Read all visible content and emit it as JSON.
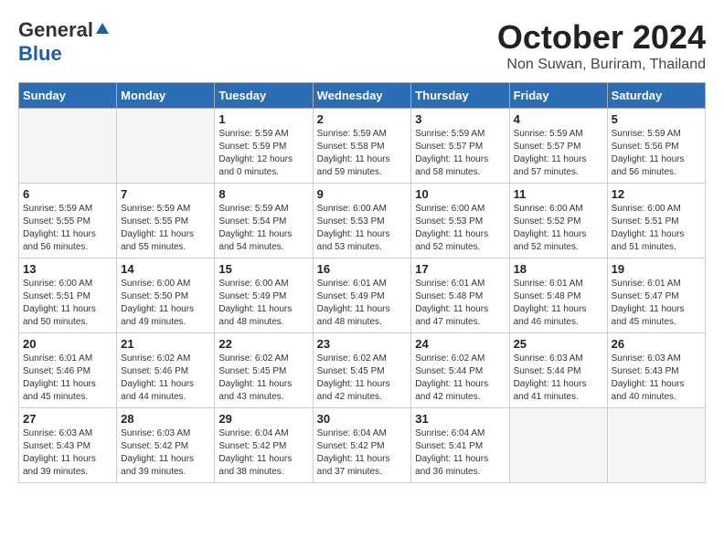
{
  "logo": {
    "general": "General",
    "blue": "Blue"
  },
  "title": "October 2024",
  "location": "Non Suwan, Buriram, Thailand",
  "days_of_week": [
    "Sunday",
    "Monday",
    "Tuesday",
    "Wednesday",
    "Thursday",
    "Friday",
    "Saturday"
  ],
  "weeks": [
    [
      {
        "day": "",
        "info": ""
      },
      {
        "day": "",
        "info": ""
      },
      {
        "day": "1",
        "info": "Sunrise: 5:59 AM\nSunset: 5:59 PM\nDaylight: 12 hours\nand 0 minutes."
      },
      {
        "day": "2",
        "info": "Sunrise: 5:59 AM\nSunset: 5:58 PM\nDaylight: 11 hours\nand 59 minutes."
      },
      {
        "day": "3",
        "info": "Sunrise: 5:59 AM\nSunset: 5:57 PM\nDaylight: 11 hours\nand 58 minutes."
      },
      {
        "day": "4",
        "info": "Sunrise: 5:59 AM\nSunset: 5:57 PM\nDaylight: 11 hours\nand 57 minutes."
      },
      {
        "day": "5",
        "info": "Sunrise: 5:59 AM\nSunset: 5:56 PM\nDaylight: 11 hours\nand 56 minutes."
      }
    ],
    [
      {
        "day": "6",
        "info": "Sunrise: 5:59 AM\nSunset: 5:55 PM\nDaylight: 11 hours\nand 56 minutes."
      },
      {
        "day": "7",
        "info": "Sunrise: 5:59 AM\nSunset: 5:55 PM\nDaylight: 11 hours\nand 55 minutes."
      },
      {
        "day": "8",
        "info": "Sunrise: 5:59 AM\nSunset: 5:54 PM\nDaylight: 11 hours\nand 54 minutes."
      },
      {
        "day": "9",
        "info": "Sunrise: 6:00 AM\nSunset: 5:53 PM\nDaylight: 11 hours\nand 53 minutes."
      },
      {
        "day": "10",
        "info": "Sunrise: 6:00 AM\nSunset: 5:53 PM\nDaylight: 11 hours\nand 52 minutes."
      },
      {
        "day": "11",
        "info": "Sunrise: 6:00 AM\nSunset: 5:52 PM\nDaylight: 11 hours\nand 52 minutes."
      },
      {
        "day": "12",
        "info": "Sunrise: 6:00 AM\nSunset: 5:51 PM\nDaylight: 11 hours\nand 51 minutes."
      }
    ],
    [
      {
        "day": "13",
        "info": "Sunrise: 6:00 AM\nSunset: 5:51 PM\nDaylight: 11 hours\nand 50 minutes."
      },
      {
        "day": "14",
        "info": "Sunrise: 6:00 AM\nSunset: 5:50 PM\nDaylight: 11 hours\nand 49 minutes."
      },
      {
        "day": "15",
        "info": "Sunrise: 6:00 AM\nSunset: 5:49 PM\nDaylight: 11 hours\nand 48 minutes."
      },
      {
        "day": "16",
        "info": "Sunrise: 6:01 AM\nSunset: 5:49 PM\nDaylight: 11 hours\nand 48 minutes."
      },
      {
        "day": "17",
        "info": "Sunrise: 6:01 AM\nSunset: 5:48 PM\nDaylight: 11 hours\nand 47 minutes."
      },
      {
        "day": "18",
        "info": "Sunrise: 6:01 AM\nSunset: 5:48 PM\nDaylight: 11 hours\nand 46 minutes."
      },
      {
        "day": "19",
        "info": "Sunrise: 6:01 AM\nSunset: 5:47 PM\nDaylight: 11 hours\nand 45 minutes."
      }
    ],
    [
      {
        "day": "20",
        "info": "Sunrise: 6:01 AM\nSunset: 5:46 PM\nDaylight: 11 hours\nand 45 minutes."
      },
      {
        "day": "21",
        "info": "Sunrise: 6:02 AM\nSunset: 5:46 PM\nDaylight: 11 hours\nand 44 minutes."
      },
      {
        "day": "22",
        "info": "Sunrise: 6:02 AM\nSunset: 5:45 PM\nDaylight: 11 hours\nand 43 minutes."
      },
      {
        "day": "23",
        "info": "Sunrise: 6:02 AM\nSunset: 5:45 PM\nDaylight: 11 hours\nand 42 minutes."
      },
      {
        "day": "24",
        "info": "Sunrise: 6:02 AM\nSunset: 5:44 PM\nDaylight: 11 hours\nand 42 minutes."
      },
      {
        "day": "25",
        "info": "Sunrise: 6:03 AM\nSunset: 5:44 PM\nDaylight: 11 hours\nand 41 minutes."
      },
      {
        "day": "26",
        "info": "Sunrise: 6:03 AM\nSunset: 5:43 PM\nDaylight: 11 hours\nand 40 minutes."
      }
    ],
    [
      {
        "day": "27",
        "info": "Sunrise: 6:03 AM\nSunset: 5:43 PM\nDaylight: 11 hours\nand 39 minutes."
      },
      {
        "day": "28",
        "info": "Sunrise: 6:03 AM\nSunset: 5:42 PM\nDaylight: 11 hours\nand 39 minutes."
      },
      {
        "day": "29",
        "info": "Sunrise: 6:04 AM\nSunset: 5:42 PM\nDaylight: 11 hours\nand 38 minutes."
      },
      {
        "day": "30",
        "info": "Sunrise: 6:04 AM\nSunset: 5:42 PM\nDaylight: 11 hours\nand 37 minutes."
      },
      {
        "day": "31",
        "info": "Sunrise: 6:04 AM\nSunset: 5:41 PM\nDaylight: 11 hours\nand 36 minutes."
      },
      {
        "day": "",
        "info": ""
      },
      {
        "day": "",
        "info": ""
      }
    ]
  ]
}
